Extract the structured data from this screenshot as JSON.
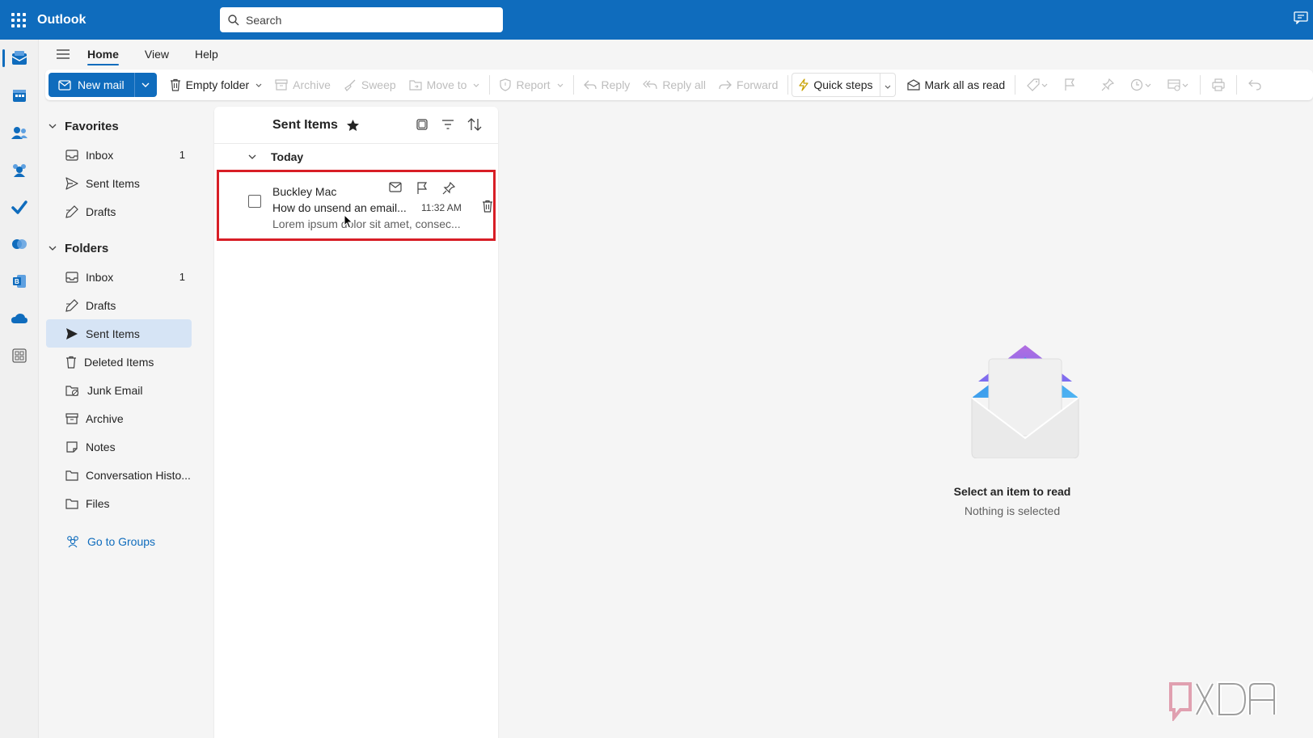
{
  "app": {
    "title": "Outlook"
  },
  "search": {
    "placeholder": "Search"
  },
  "tabs": [
    {
      "label": "Home"
    },
    {
      "label": "View"
    },
    {
      "label": "Help"
    }
  ],
  "ribbon": {
    "new_mail": "New mail",
    "empty_folder": "Empty folder",
    "archive": "Archive",
    "sweep": "Sweep",
    "move_to": "Move to",
    "report": "Report",
    "reply": "Reply",
    "reply_all": "Reply all",
    "forward": "Forward",
    "quick_steps": "Quick steps",
    "mark_all_read": "Mark all as read"
  },
  "favorites": {
    "label": "Favorites",
    "items": [
      {
        "label": "Inbox",
        "count": "1",
        "icon": "inbox-icon"
      },
      {
        "label": "Sent Items",
        "count": "",
        "icon": "send-icon"
      },
      {
        "label": "Drafts",
        "count": "",
        "icon": "drafts-icon"
      }
    ]
  },
  "folders": {
    "label": "Folders",
    "items": [
      {
        "label": "Inbox",
        "count": "1"
      },
      {
        "label": "Drafts",
        "count": ""
      },
      {
        "label": "Sent Items",
        "count": ""
      },
      {
        "label": "Deleted Items",
        "count": ""
      },
      {
        "label": "Junk Email",
        "count": ""
      },
      {
        "label": "Archive",
        "count": ""
      },
      {
        "label": "Notes",
        "count": ""
      },
      {
        "label": "Conversation Histo...",
        "count": ""
      },
      {
        "label": "Files",
        "count": ""
      }
    ],
    "go_to_groups": "Go to Groups"
  },
  "message_list": {
    "title": "Sent Items",
    "group": "Today",
    "messages": [
      {
        "sender": "Buckley Mac",
        "subject": "How do unsend an email...",
        "preview": "Lorem ipsum dolor sit amet, consec...",
        "time": "11:32 AM"
      }
    ]
  },
  "reading_pane": {
    "title": "Select an item to read",
    "subtitle": "Nothing is selected"
  },
  "colors": {
    "brand": "#0f6cbd",
    "selected_folder": "#d6e4f5",
    "highlight_border": "#d81e26"
  }
}
